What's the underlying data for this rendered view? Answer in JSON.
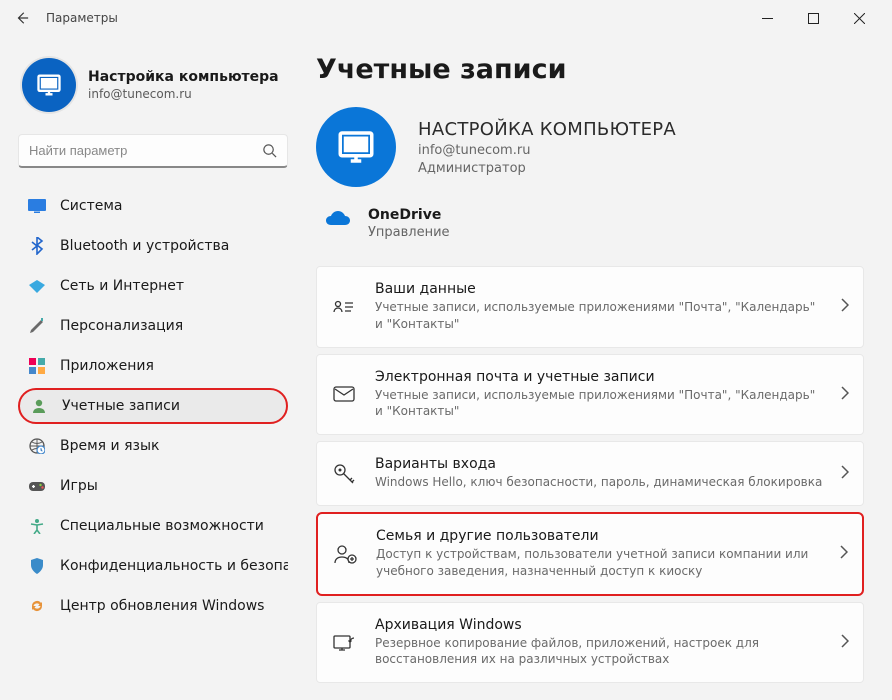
{
  "window": {
    "title": "Параметры"
  },
  "profile": {
    "name": "Настройка компьютера",
    "email": "info@tunecom.ru"
  },
  "search": {
    "placeholder": "Найти параметр"
  },
  "nav": [
    {
      "id": "system",
      "label": "Система",
      "icon": "display-blue"
    },
    {
      "id": "bluetooth",
      "label": "Bluetooth и устройства",
      "icon": "bluetooth"
    },
    {
      "id": "network",
      "label": "Сеть и Интернет",
      "icon": "wifi-diamond"
    },
    {
      "id": "personalization",
      "label": "Персонализация",
      "icon": "brush"
    },
    {
      "id": "apps",
      "label": "Приложения",
      "icon": "apps-grid"
    },
    {
      "id": "accounts",
      "label": "Учетные записи",
      "icon": "person",
      "selected": true,
      "highlighted": true
    },
    {
      "id": "time",
      "label": "Время и язык",
      "icon": "globe-clock"
    },
    {
      "id": "gaming",
      "label": "Игры",
      "icon": "gamepad"
    },
    {
      "id": "accessibility",
      "label": "Специальные возможности",
      "icon": "accessibility"
    },
    {
      "id": "privacy",
      "label": "Конфиденциальность и безопас",
      "icon": "shield"
    },
    {
      "id": "update",
      "label": "Центр обновления Windows",
      "icon": "update"
    }
  ],
  "main": {
    "heading": "Учетные записи",
    "account": {
      "name": "НАСТРОЙКА КОМПЬЮТЕРА",
      "email": "info@tunecom.ru",
      "role": "Администратор"
    },
    "onedrive": {
      "title": "OneDrive",
      "sub": "Управление"
    },
    "cards": [
      {
        "id": "your-info",
        "icon": "id-card",
        "title": "Ваши данные",
        "sub": "Учетные записи, используемые приложениями \"Почта\", \"Календарь\" и \"Контакты\""
      },
      {
        "id": "email-accounts",
        "icon": "envelope",
        "title": "Электронная почта и учетные записи",
        "sub": "Учетные записи, используемые приложениями \"Почта\", \"Календарь\" и \"Контакты\""
      },
      {
        "id": "signin-options",
        "icon": "key",
        "title": "Варианты входа",
        "sub": "Windows Hello, ключ безопасности, пароль, динамическая блокировка"
      },
      {
        "id": "family",
        "icon": "family",
        "title": "Семья и другие пользователи",
        "sub": "Доступ к устройствам, пользователи учетной записи компании или учебного заведения, назначенный доступ к киоску",
        "highlighted": true
      },
      {
        "id": "backup",
        "icon": "backup",
        "title": "Архивация Windows",
        "sub": "Резервное копирование файлов, приложений, настроек для восстановления их на различных устройствах"
      }
    ]
  }
}
